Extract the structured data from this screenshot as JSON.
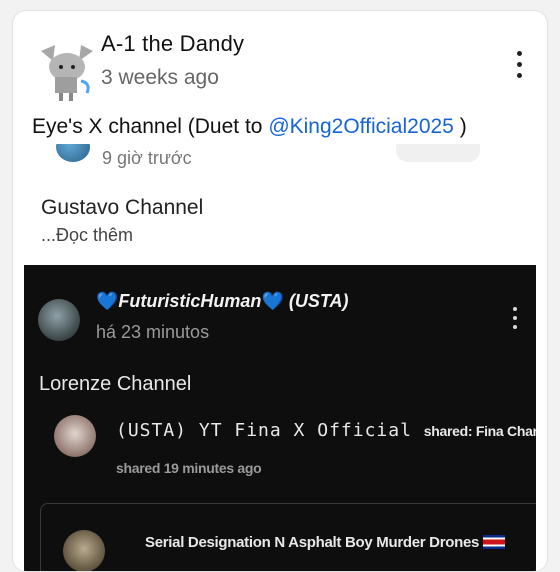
{
  "post": {
    "author": "A-1 the Dandy",
    "time": "3 weeks ago",
    "text_prefix": "Eye's X channel (Duet to ",
    "mention": "@King2Official2025",
    "text_suffix": " )"
  },
  "quoted": {
    "time": "9 giờ trước",
    "text": "Gustavo Channel",
    "more": "...Đọc thêm"
  },
  "embedded": {
    "username": "FuturisticHuman",
    "heart_left": "💙",
    "heart_right": "💙",
    "tag": "(USTA)",
    "time": "há 23 minutos",
    "text": "Lorenze Channel",
    "shared": {
      "username": "(USTA) YT Fina X Official",
      "shared_label": "shared: Fina Channel",
      "time": "shared 19 minutes ago"
    },
    "nested": {
      "username": "Serial Designation N Asphalt Boy Murder Drones"
    }
  },
  "colors": {
    "mention": "#1565d8",
    "heart": "#4da3ff",
    "dark_bg": "#0e0e0e"
  },
  "icons": {
    "menu": "more-vertical-icon",
    "flag": "costa-rica-flag-icon"
  }
}
